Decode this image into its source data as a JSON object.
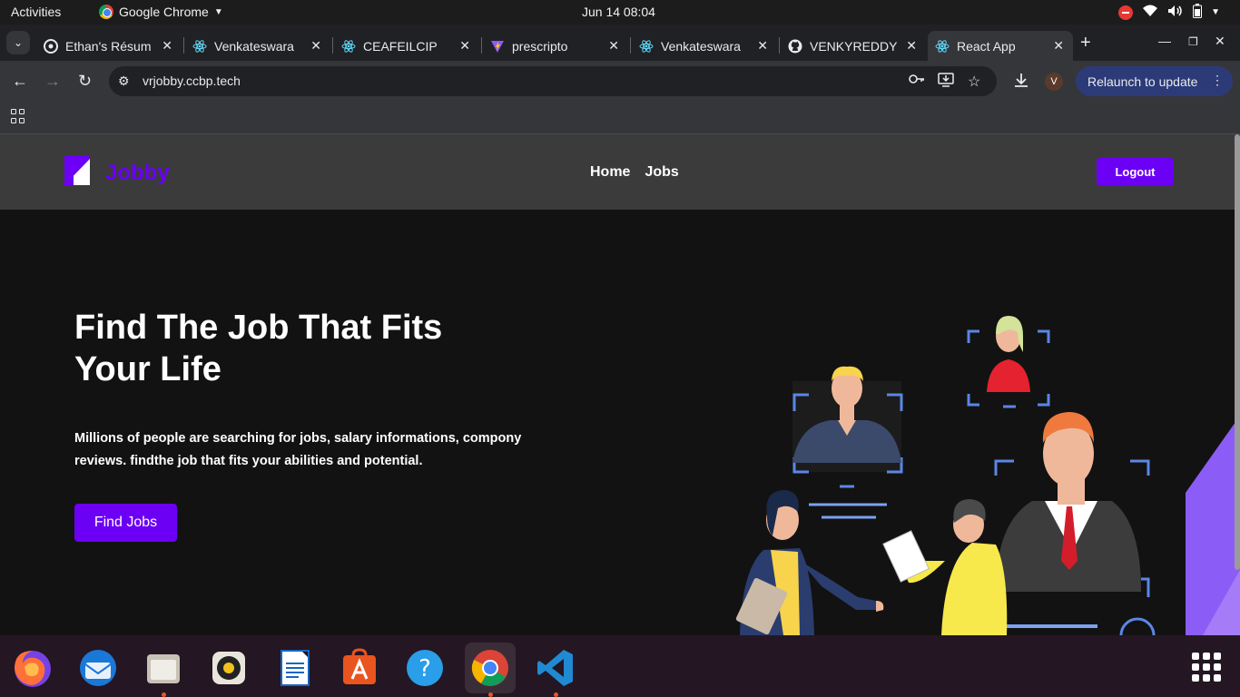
{
  "system": {
    "activities": "Activities",
    "app_name": "Google Chrome",
    "clock": "Jun 14  08:04"
  },
  "browser": {
    "tabs": [
      {
        "title": "Ethan's Résum",
        "icon": "resume-icon"
      },
      {
        "title": "Venkateswara",
        "icon": "react-icon"
      },
      {
        "title": "CEAFEILCIP",
        "icon": "react-icon"
      },
      {
        "title": "prescripto",
        "icon": "vite-icon"
      },
      {
        "title": "Venkateswara",
        "icon": "react-icon"
      },
      {
        "title": "VENKYREDDY",
        "icon": "github-icon"
      },
      {
        "title": "React App",
        "icon": "react-icon",
        "active": true
      }
    ],
    "url": "vrjobby.ccbp.tech",
    "relaunch_label": "Relaunch to update",
    "avatar_letter": "V"
  },
  "page": {
    "brand": "Jobby",
    "nav": {
      "home": "Home",
      "jobs": "Jobs"
    },
    "logout_label": "Logout",
    "hero": {
      "title": "Find The Job That Fits Your Life",
      "description": "Millions of people are searching for jobs, salary informations, compony reviews. findthe job that fits your abilities and potential.",
      "cta": "Find Jobs"
    }
  },
  "colors": {
    "accent": "#6b00f5",
    "navbar_bg": "#3b3b3b",
    "page_bg": "#121212"
  },
  "dock": {
    "items": [
      "firefox-icon",
      "thunderbird-icon",
      "files-icon",
      "rhythmbox-icon",
      "writer-icon",
      "app-center-icon",
      "help-icon",
      "chrome-icon",
      "vscode-icon"
    ]
  }
}
